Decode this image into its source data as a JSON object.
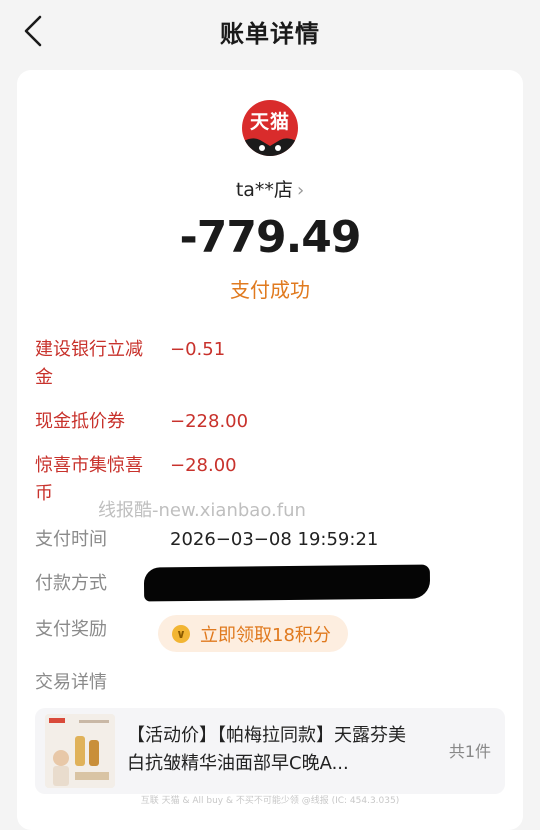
{
  "header": {
    "title": "账单详情"
  },
  "merchant": {
    "logo_text": "天猫",
    "name": "ta**店",
    "chevron": "›"
  },
  "payment": {
    "amount": "-779.49",
    "status": "支付成功"
  },
  "discounts": [
    {
      "label": "建设银行立减金",
      "value": "−0.51"
    },
    {
      "label": "现金抵价券",
      "value": "−228.00"
    },
    {
      "label": "惊喜市集惊喜币",
      "value": "−28.00"
    }
  ],
  "watermark": "线报酷-new.xianbao.fun",
  "details": {
    "pay_time_label": "支付时间",
    "pay_time_value": "2026−03−08 19:59:21",
    "method_label": "付款方式",
    "reward_label": "支付奖励",
    "reward_button": "立即领取18积分",
    "trade_label": "交易详情"
  },
  "product": {
    "title": "【活动价】【帕梅拉同款】天露芬美白抗皱精华油面部早C晚A...",
    "count": "共1件"
  },
  "footer_note": "互联 天猫 & All buy & 不买不可能少领 @线报 (IC: 454.3.035)",
  "colors": {
    "accent_red": "#c8322c",
    "orange": "#e07a1f",
    "tmall_red": "#d92c2c"
  }
}
